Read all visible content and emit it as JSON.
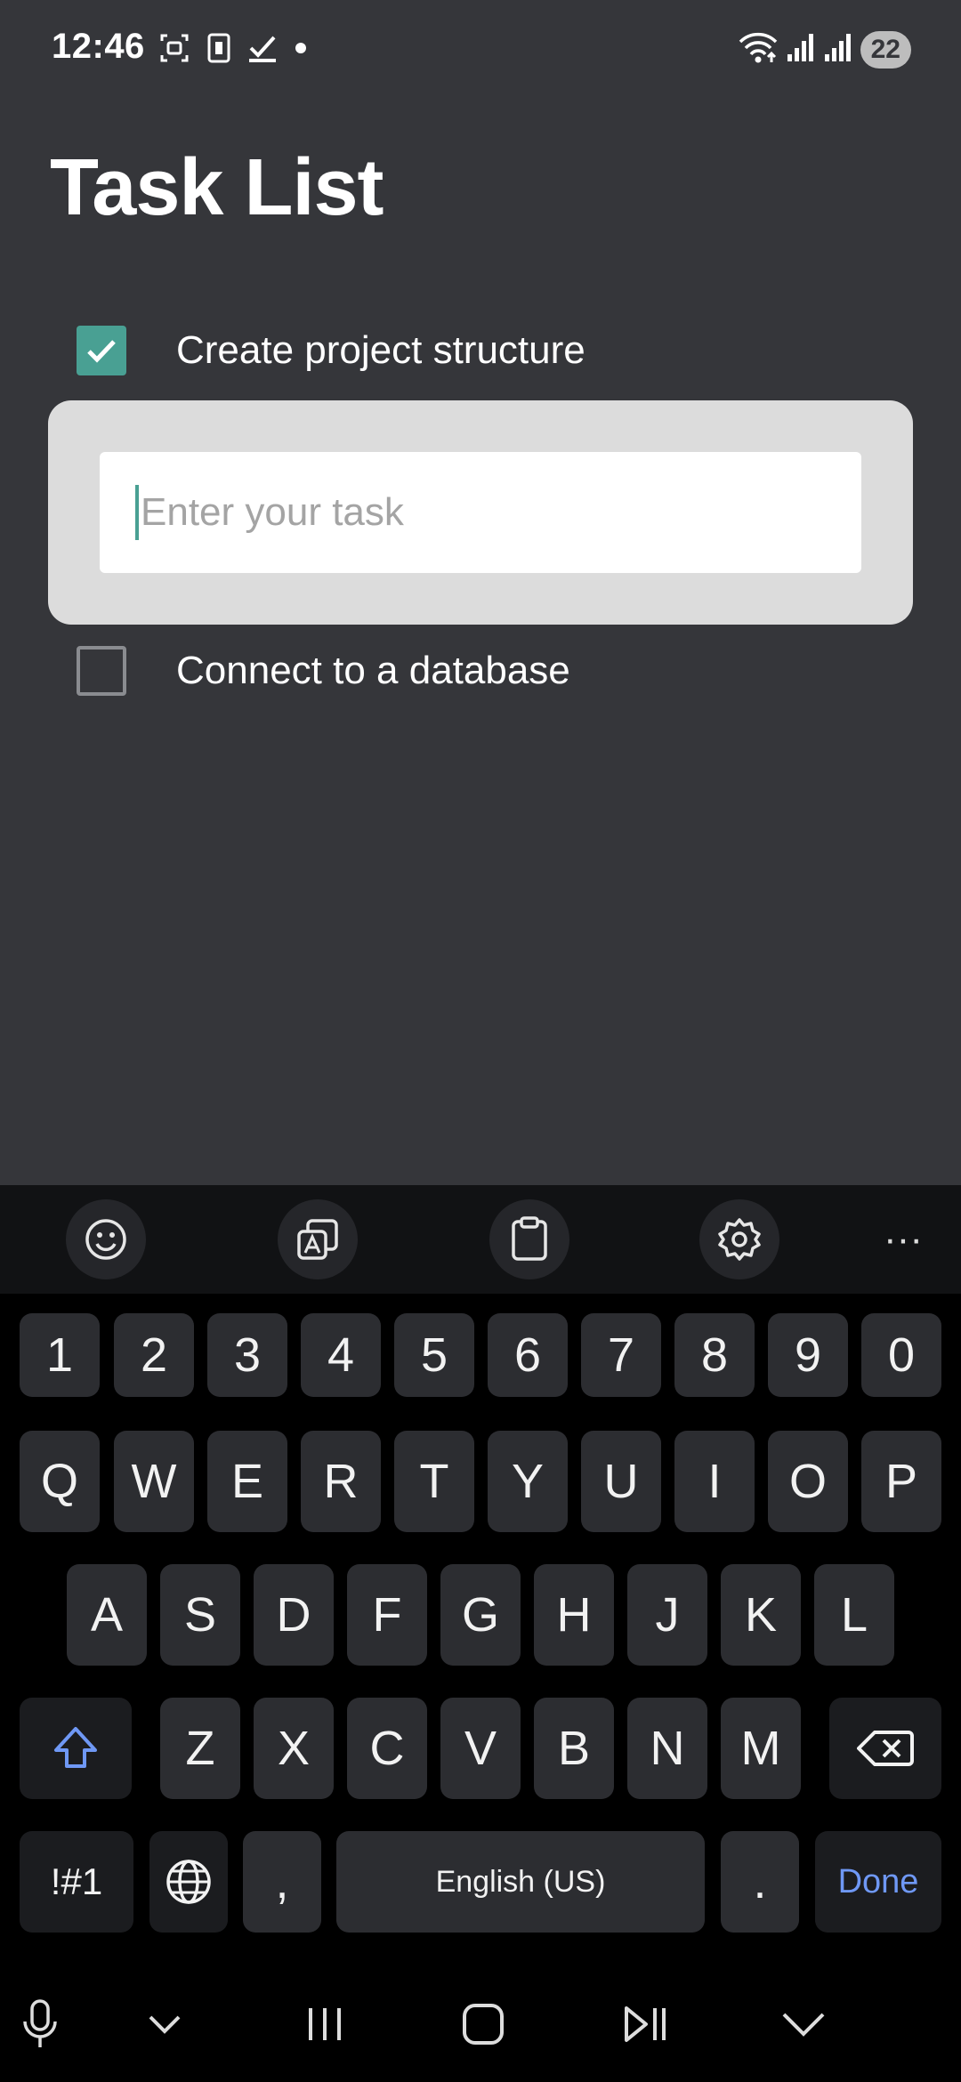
{
  "status_bar": {
    "time": "12:46",
    "battery": "22"
  },
  "page": {
    "title": "Task List"
  },
  "tasks": [
    {
      "label": "Create project structure",
      "checked": true
    },
    {
      "label": "Connect to a database",
      "checked": false
    }
  ],
  "input": {
    "placeholder": "Enter your task",
    "value": ""
  },
  "keyboard": {
    "toolbar": [
      "emoji-icon",
      "translate-icon",
      "clipboard-icon",
      "gear-icon",
      "more-icon"
    ],
    "toolbar_more": "···",
    "number_row": [
      "1",
      "2",
      "3",
      "4",
      "5",
      "6",
      "7",
      "8",
      "9",
      "0"
    ],
    "row1": [
      "Q",
      "W",
      "E",
      "R",
      "T",
      "Y",
      "U",
      "I",
      "O",
      "P"
    ],
    "row2": [
      "A",
      "S",
      "D",
      "F",
      "G",
      "H",
      "J",
      "K",
      "L"
    ],
    "row3": [
      "Z",
      "X",
      "C",
      "V",
      "B",
      "N",
      "M"
    ],
    "symbols_key": "!#1",
    "comma_key": ",",
    "space_key": "English (US)",
    "period_key": ".",
    "done_key": "Done",
    "accent_color": "#6f98f5"
  },
  "colors": {
    "background": "#35363a",
    "checkbox": "#49a093",
    "card": "#dcdcdc"
  }
}
